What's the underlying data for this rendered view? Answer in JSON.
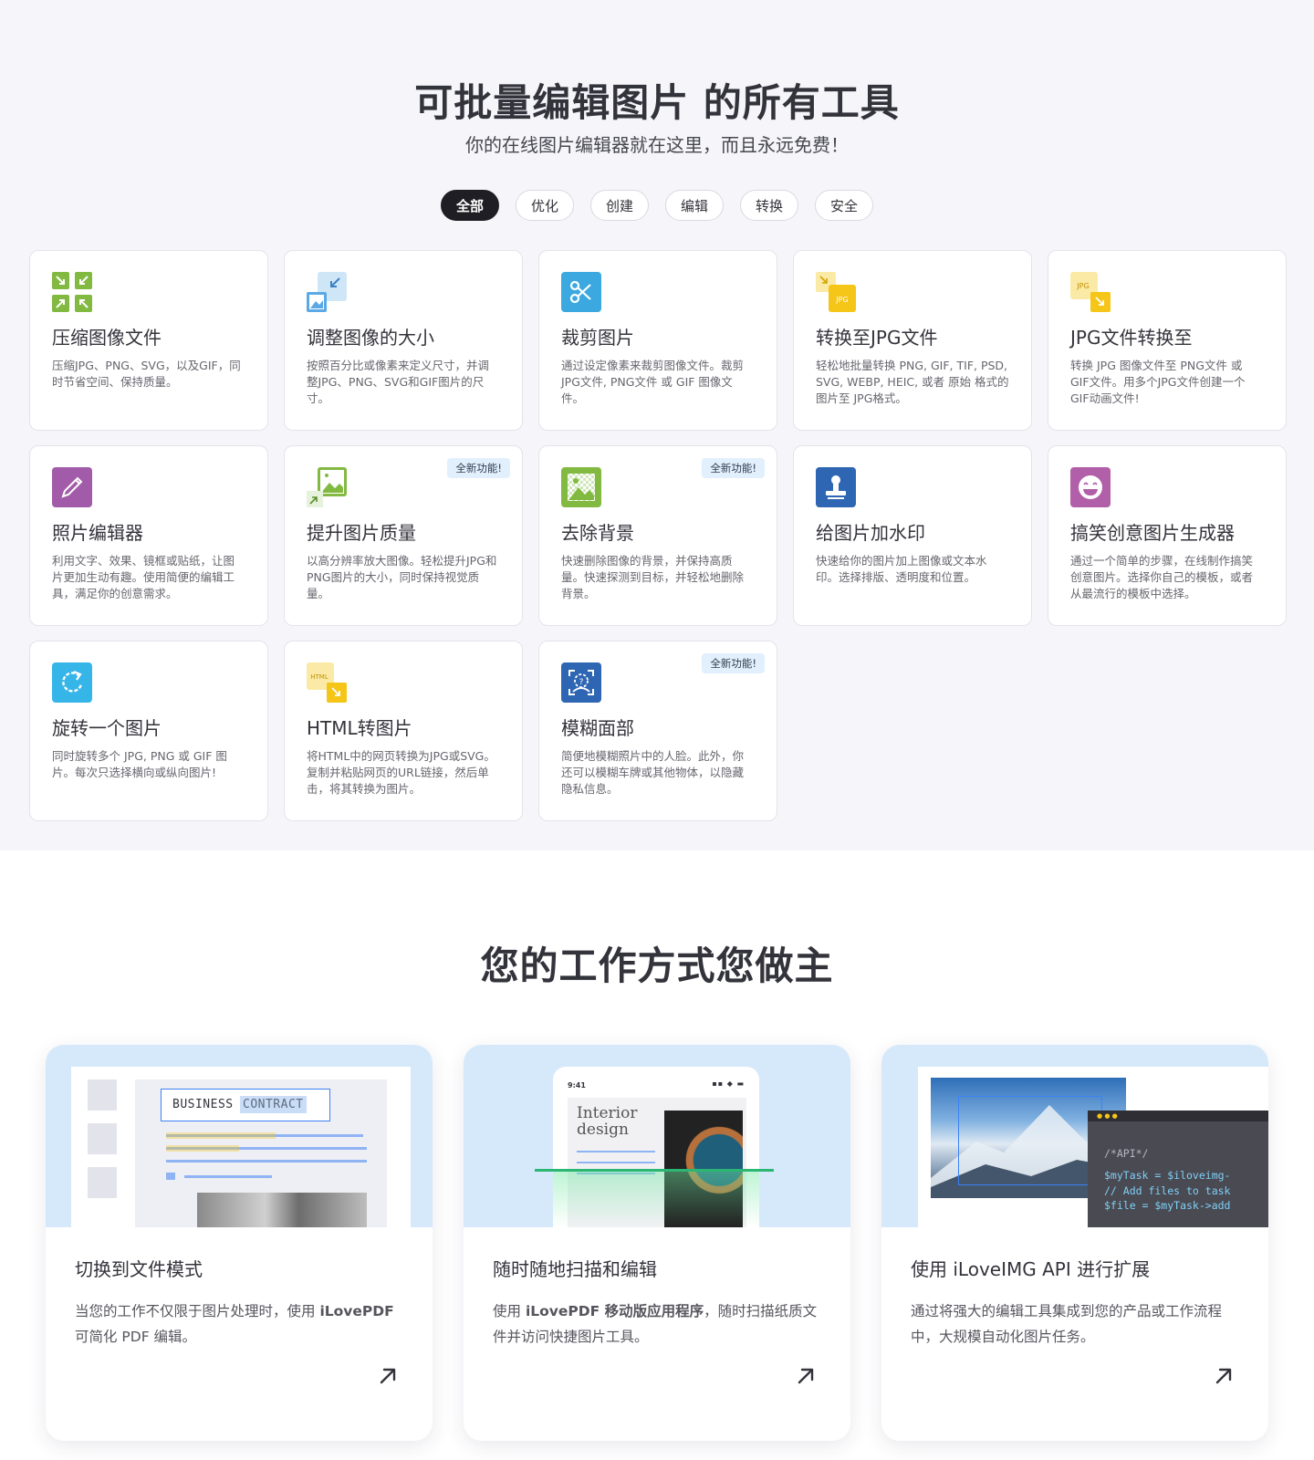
{
  "tools": {
    "title": "可批量编辑图片 的所有工具",
    "subtitle": "你的在线图片编辑器就在这里，而且永远免费！",
    "filters": [
      "全部",
      "优化",
      "创建",
      "编辑",
      "转换",
      "安全"
    ],
    "active_filter": "全部",
    "new_badge": "全新功能!",
    "cards": [
      {
        "title": "压缩图像文件",
        "desc": "压缩JPG、PNG、SVG，以及GIF，同时节省空间、保持质量。",
        "icon": "compress-icon",
        "color": "#82b941"
      },
      {
        "title": "调整图像的大小",
        "desc": "按照百分比或像素来定义尺寸，并调整JPG、PNG、SVG和GIF图片的尺寸。",
        "icon": "resize-icon",
        "color": "#5aa9e6"
      },
      {
        "title": "裁剪图片",
        "desc": "通过设定像素来裁剪图像文件。裁剪 JPG文件, PNG文件 或 GIF 图像文件。",
        "icon": "scissors-icon",
        "color": "#3ba9e0"
      },
      {
        "title": "转换至JPG文件",
        "desc": "轻松地批量转换 PNG, GIF, TIF, PSD, SVG, WEBP, HEIC, 或者 原始 格式的图片至 JPG格式。",
        "icon": "to-jpg-icon",
        "color": "#f5c518",
        "icon_text": "JPG"
      },
      {
        "title": "JPG文件转换至",
        "desc": "转换 JPG 图像文件至 PNG文件 或 GIF文件。用多个JPG文件创建一个 GIF动画文件!",
        "icon": "from-jpg-icon",
        "color": "#f5c518",
        "icon_text": "JPG"
      },
      {
        "title": "照片编辑器",
        "desc": "利用文字、效果、镜框或贴纸，让图片更加生动有趣。使用简便的编辑工具，满足你的创意需求。",
        "icon": "pencil-icon",
        "color": "#a25ba8"
      },
      {
        "title": "提升图片质量",
        "desc": "以高分辨率放大图像。轻松提升JPG和PNG图片的大小，同时保持视觉质量。",
        "icon": "upscale-icon",
        "color": "#82b941",
        "is_new": true
      },
      {
        "title": "去除背景",
        "desc": "快速删除图像的背景，并保持高质量。快速探测到目标，并轻松地删除背景。",
        "icon": "remove-background-icon",
        "color": "#82b941",
        "is_new": true
      },
      {
        "title": "给图片加水印",
        "desc": "快速给你的图片加上图像或文本水印。选择排版、透明度和位置。",
        "icon": "stamp-icon",
        "color": "#2f66b3"
      },
      {
        "title": "搞笑创意图片生成器",
        "desc": "通过一个简单的步骤，在线制作搞笑创意图片。选择你自己的模板，或者从最流行的模板中选择。",
        "icon": "laughing-face-icon",
        "color": "#b05fa8"
      },
      {
        "title": "旋转一个图片",
        "desc": "同时旋转多个 JPG, PNG 或 GIF 图片。每次只选择横向或纵向图片!",
        "icon": "rotate-icon",
        "color": "#35b5e8"
      },
      {
        "title": "HTML转图片",
        "desc": "将HTML中的网页转换为JPG或SVG。复制并粘贴网页的URL链接，然后单击，将其转换为图片。",
        "icon": "html-icon",
        "color": "#f5c518",
        "icon_text": "HTML"
      },
      {
        "title": "模糊面部",
        "desc": "简便地模糊照片中的人脸。此外，你还可以模糊车牌或其他物体，以隐藏隐私信息。",
        "icon": "blur-face-icon",
        "color": "#2f66b3",
        "is_new": true
      }
    ]
  },
  "work": {
    "title": "您的工作方式您做主",
    "cards": [
      {
        "title": "切换到文件模式",
        "desc_parts": [
          "当您的工作不仅限于图片处理时，使用 ",
          "iLovePDF",
          " 可简化 PDF 编辑。"
        ],
        "banner_text_a": "BUSINESS",
        "banner_text_b": "CONTRACT"
      },
      {
        "title": "随时随地扫描和编辑",
        "desc_parts": [
          "使用 ",
          "iLovePDF 移动版应用程序",
          "，随时扫描纸质文件并访问快捷图片工具。"
        ],
        "banner_time": "9:41",
        "banner_line1": "Interior",
        "banner_line2": "design"
      },
      {
        "title": "使用 iLoveIMG API 进行扩展",
        "desc_parts": [
          "通过将强大的编辑工具集成到您的产品或工作流程中，大规模自动化图片任务。",
          "",
          ""
        ],
        "code_lines": [
          "/*API*/",
          "$myTask = $iloveimg-",
          "// Add files to task",
          "$file = $myTask->add"
        ]
      }
    ]
  }
}
